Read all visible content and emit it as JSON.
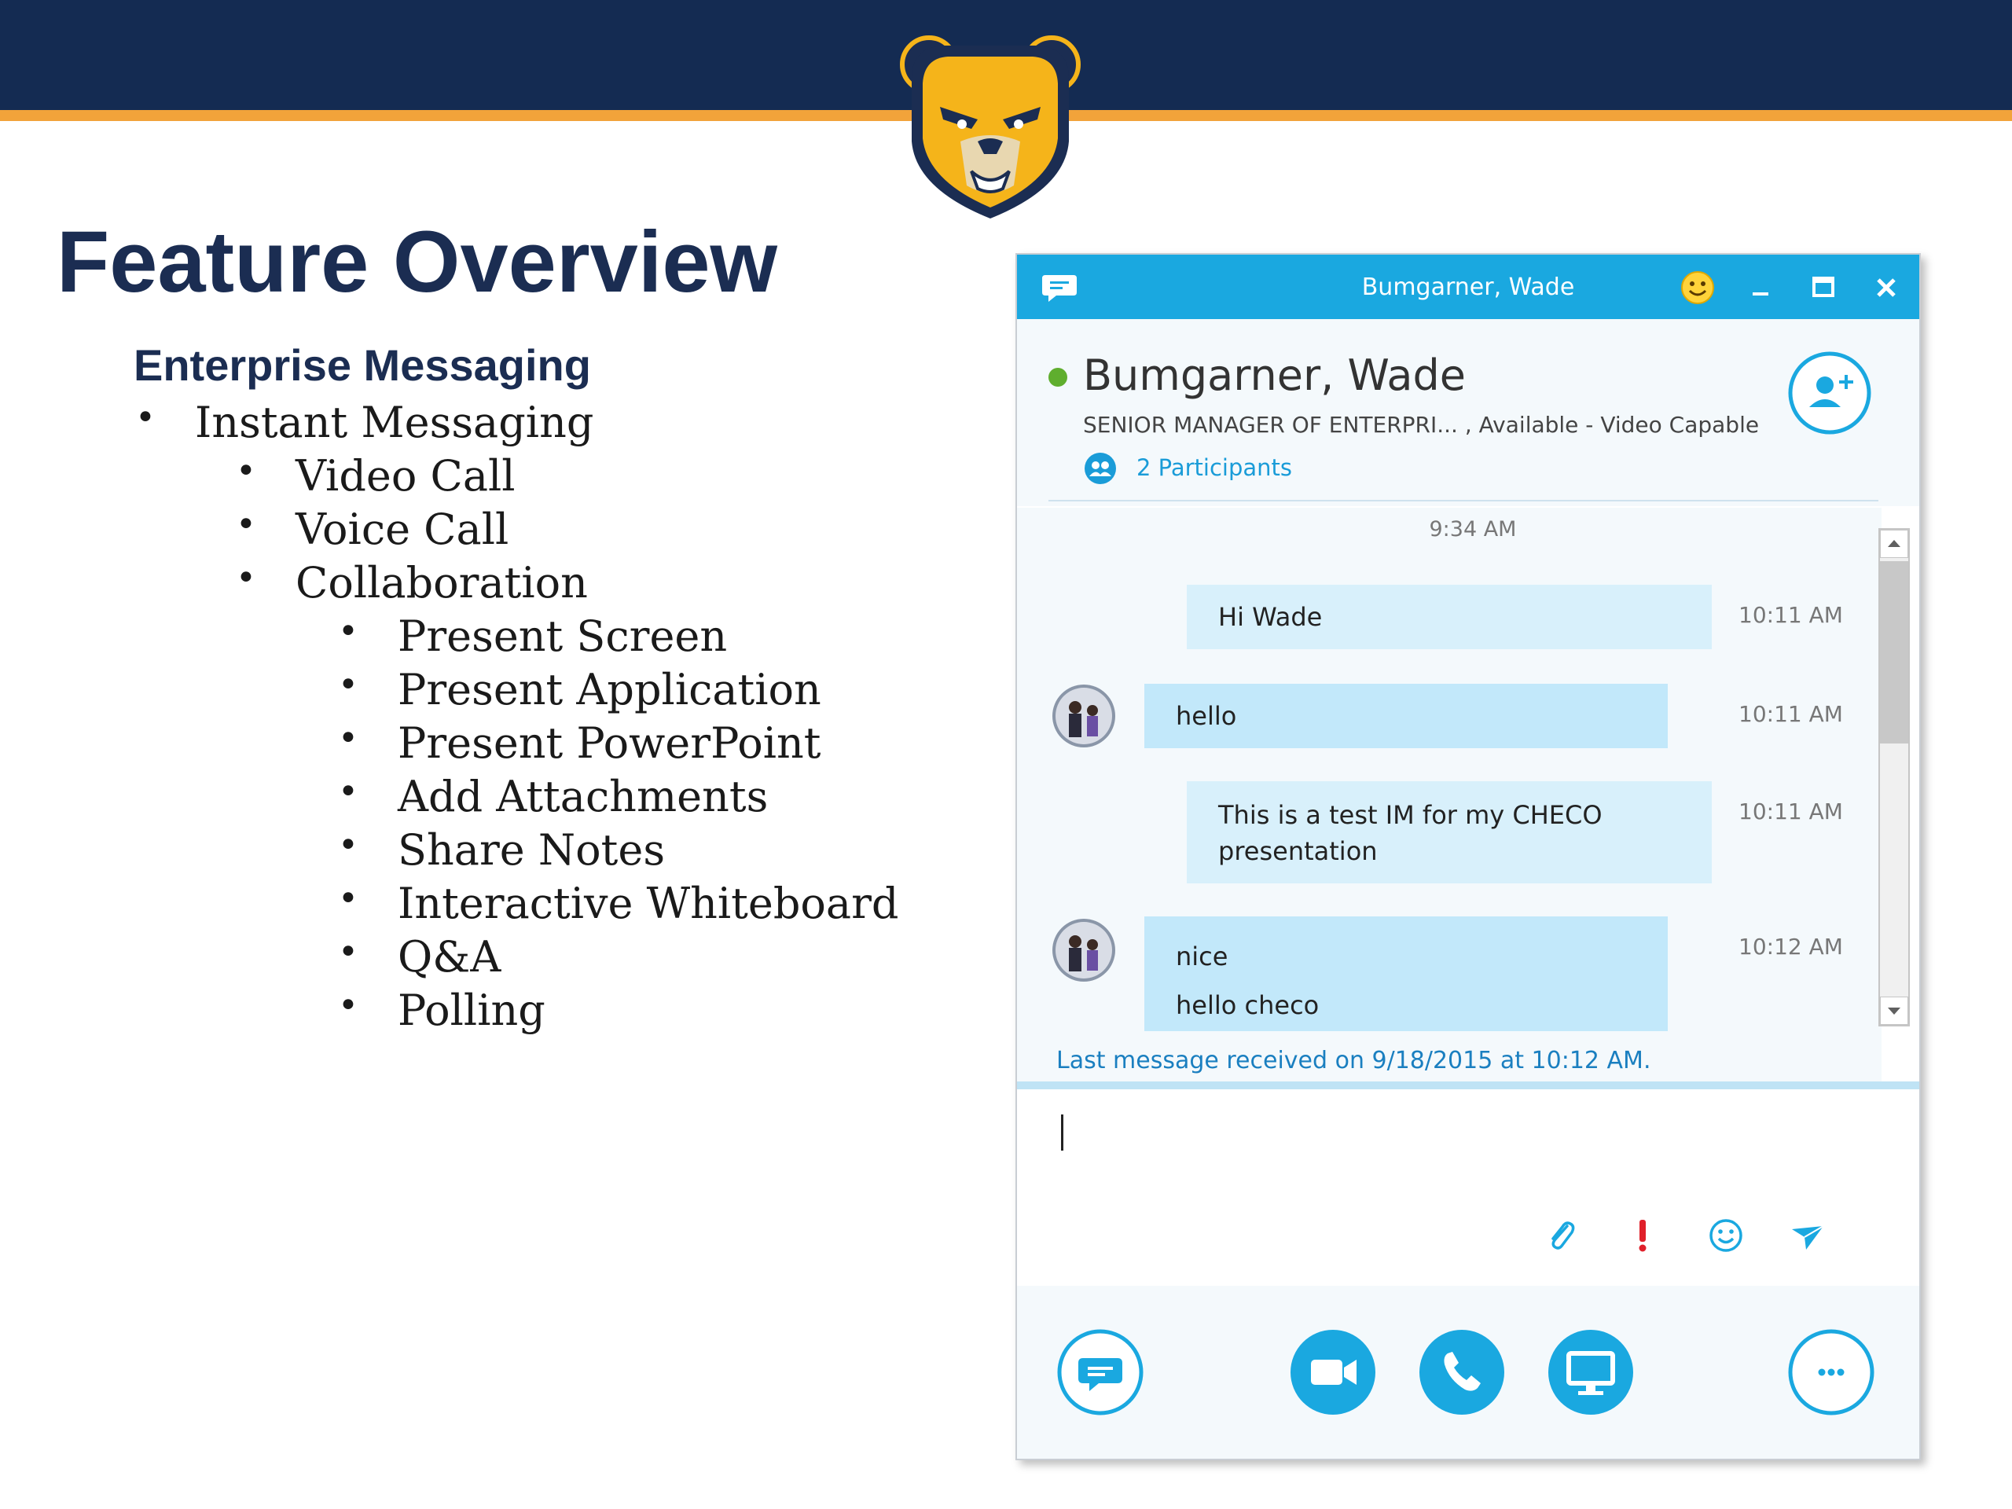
{
  "slide": {
    "title": "Feature Overview",
    "subtitle": "Enterprise Messaging",
    "bullets": [
      {
        "text": "Instant Messaging",
        "level": 1
      },
      {
        "text": "Video Call",
        "level": 2
      },
      {
        "text": "Voice Call",
        "level": 2
      },
      {
        "text": "Collaboration",
        "level": 2
      },
      {
        "text": "Present Screen",
        "level": 3
      },
      {
        "text": "Present Application",
        "level": 3
      },
      {
        "text": "Present PowerPoint",
        "level": 3
      },
      {
        "text": "Add Attachments",
        "level": 3
      },
      {
        "text": "Share Notes",
        "level": 3
      },
      {
        "text": "Interactive Whiteboard",
        "level": 3
      },
      {
        "text": "Q&A",
        "level": 3
      },
      {
        "text": "Polling",
        "level": 3
      }
    ],
    "bullet_glyph": "•",
    "colors": {
      "banner": "#142b52",
      "stripe": "#f2a33a",
      "logo_gold": "#f5b41a"
    }
  },
  "window": {
    "title": "Bumgarner, Wade",
    "accent": "#1aa8e0",
    "titlebar_icons": [
      "chat-icon",
      "emoji-icon",
      "minimize-icon",
      "maximize-icon",
      "close-icon"
    ],
    "contact": {
      "name": "Bumgarner, Wade",
      "role": "SENIOR MANAGER OF ENTERPRI... ,",
      "status": "Available - Video Capable",
      "presence_color": "#5fae2e",
      "participants": "2 Participants"
    },
    "conversation": {
      "start_time": "9:34 AM",
      "messages": [
        {
          "lines": [
            "Hi Wade"
          ],
          "time": "10:11 AM",
          "from_contact": false
        },
        {
          "lines": [
            "hello"
          ],
          "time": "10:11 AM",
          "from_contact": true
        },
        {
          "lines": [
            "This is a test IM for my CHECO",
            "presentation"
          ],
          "time": "10:11 AM",
          "from_contact": false
        },
        {
          "lines": [
            "nice",
            "hello checo"
          ],
          "time": "10:12 AM",
          "from_contact": true
        }
      ],
      "last_message": "Last message received on 9/18/2015 at 10:12 AM."
    },
    "compose_icons": [
      "attachment-icon",
      "importance-icon",
      "emoticon-icon",
      "send-icon"
    ],
    "action_buttons": [
      "im-button",
      "video-call-button",
      "voice-call-button",
      "present-button",
      "more-options-button"
    ]
  }
}
